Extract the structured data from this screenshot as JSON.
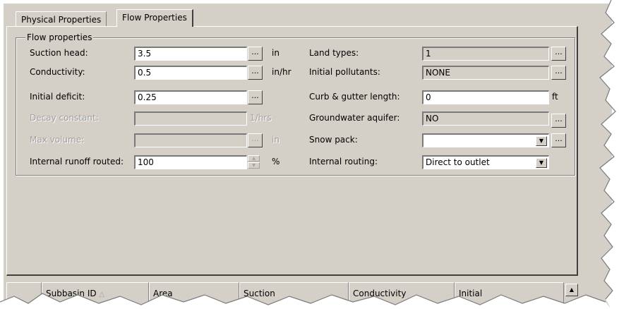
{
  "tabs": [
    {
      "label": "Physical Properties",
      "active": false
    },
    {
      "label": "Flow Properties",
      "active": true
    }
  ],
  "group": {
    "legend": "Flow properties"
  },
  "left_fields": [
    {
      "label": "Suction head:",
      "value": "3.5",
      "button": "...",
      "unit": "in",
      "state": "enabled"
    },
    {
      "label": "Conductivity:",
      "value": "0.5",
      "button": "...",
      "unit": "in/hr",
      "state": "enabled"
    },
    {
      "label": "Initial deficit:",
      "value": "0.25",
      "button": "...",
      "unit": "",
      "state": "enabled"
    },
    {
      "label": "Decay constant:",
      "value": "",
      "button": "",
      "unit": "1/hrs",
      "state": "disabled"
    },
    {
      "label": "Max volume:",
      "value": "",
      "button": "...",
      "unit": "in",
      "state": "disabled"
    },
    {
      "label": "Internal runoff routed:",
      "value": "100",
      "button": "",
      "unit": "%",
      "state": "spinner"
    }
  ],
  "right_fields": [
    {
      "label": "Land types:",
      "value": "1",
      "button": "...",
      "unit": "",
      "type": "readonly"
    },
    {
      "label": "Initial pollutants:",
      "value": "NONE",
      "button": "...",
      "unit": "",
      "type": "readonly"
    },
    {
      "label": "Curb & gutter length:",
      "value": "0",
      "button": "",
      "unit": "ft",
      "type": "text"
    },
    {
      "label": "Groundwater aquifer:",
      "value": "NO",
      "button": "...",
      "unit": "",
      "type": "readonly"
    },
    {
      "label": "Snow pack:",
      "value": "",
      "button": "...",
      "unit": "",
      "type": "select"
    },
    {
      "label": "Internal routing:",
      "value": "Direct to outlet",
      "button": "",
      "unit": "",
      "type": "select"
    }
  ],
  "grid": {
    "columns": [
      "",
      "Subbasin ID",
      "Area",
      "Suction",
      "Conductivity",
      "Initial"
    ],
    "sort_indicator": "△"
  },
  "icons": {
    "dropdown": "chevron-down-icon",
    "scroll_up": "scroll-up-arrow-icon",
    "spinner": "spinner-arrows-icon"
  }
}
